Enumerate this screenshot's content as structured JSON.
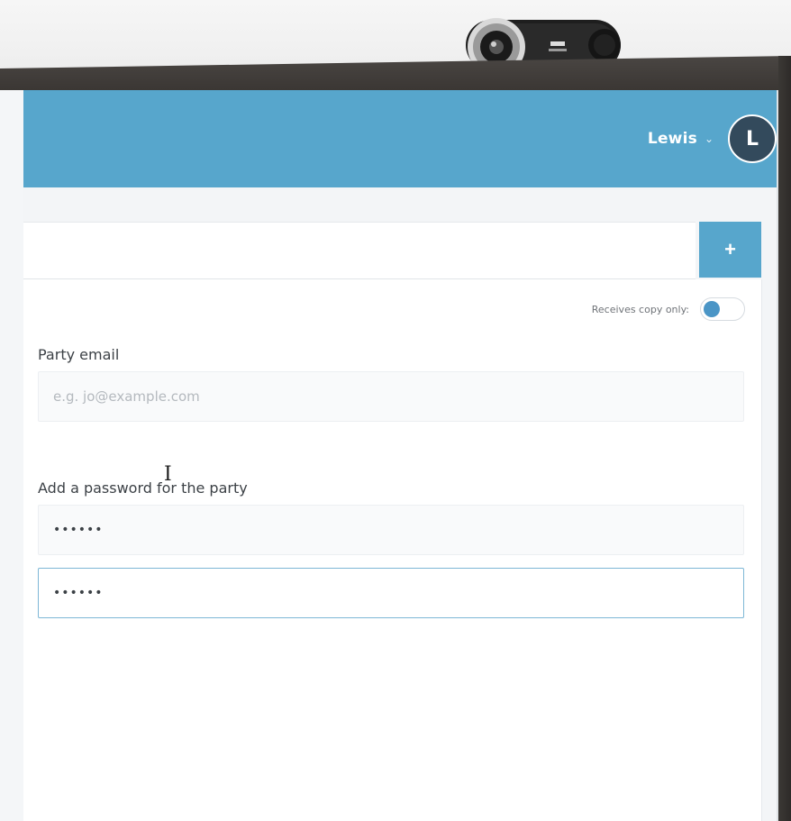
{
  "header": {
    "user_name": "Lewis",
    "chevron": "⌄",
    "avatar_initial": "L",
    "brand_color": "#57a6cc"
  },
  "toolbar": {
    "add_label": "+"
  },
  "form": {
    "copy_only_label": "Receives copy only:",
    "email_label": "Party email",
    "email_placeholder": "e.g. jo@example.com",
    "email_value": "",
    "password_label": "Add a password for the party",
    "password_value": "••••••",
    "password_confirm_value": "••••••"
  },
  "icons": {
    "add": "plus-icon",
    "user_menu": "chevron-down-icon",
    "cursor": "text-cursor-icon"
  }
}
